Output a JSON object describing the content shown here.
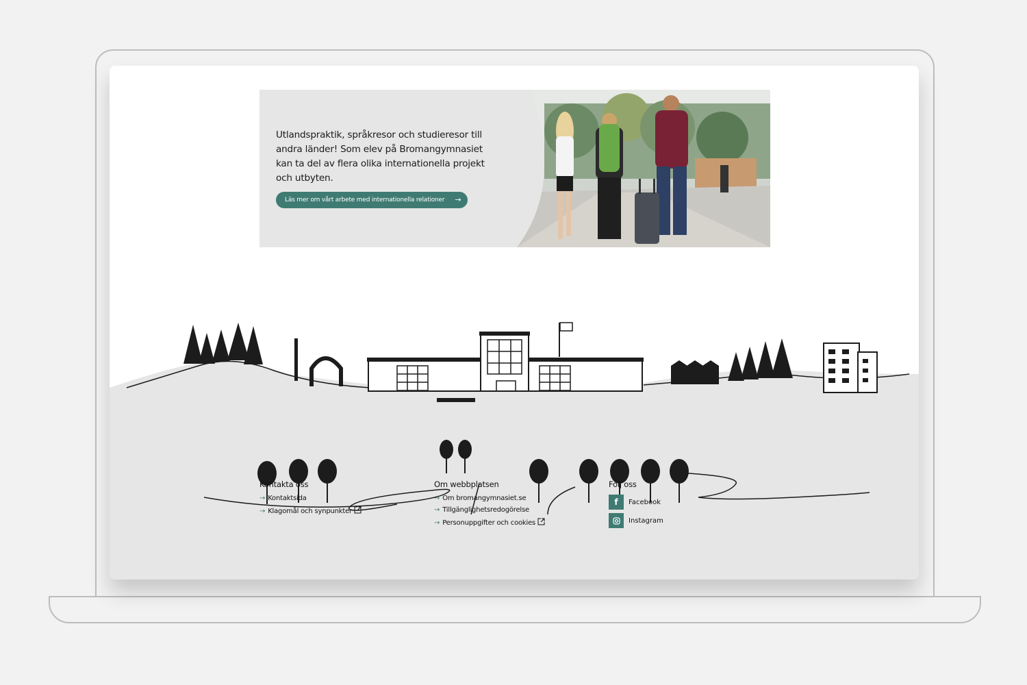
{
  "banner": {
    "text": "Utlandspraktik, språkresor och studieresor till andra länder! Som elev på Bromangymnasiet kan ta del av flera olika internationella projekt och utbyten.",
    "button_label": "Läs mer om vårt arbete med internationella relationer",
    "button_icon": "arrow-right-icon"
  },
  "footer": {
    "contact": {
      "heading": "Kontakta oss",
      "links": [
        "Kontaktsida",
        "Klagomål och synpunkter"
      ]
    },
    "about": {
      "heading": "Om webbplatsen",
      "links": [
        "Om bromangymnasiet.se",
        "Tillgänglighetsredogörelse",
        "Personuppgifter och cookies"
      ]
    },
    "follow": {
      "heading": "Följ oss",
      "links": [
        "Facebook",
        "Instagram"
      ]
    }
  },
  "colors": {
    "accent": "#3f7b73",
    "footer_bg": "#e6e6e6",
    "banner_bg": "#e6e6e6"
  }
}
